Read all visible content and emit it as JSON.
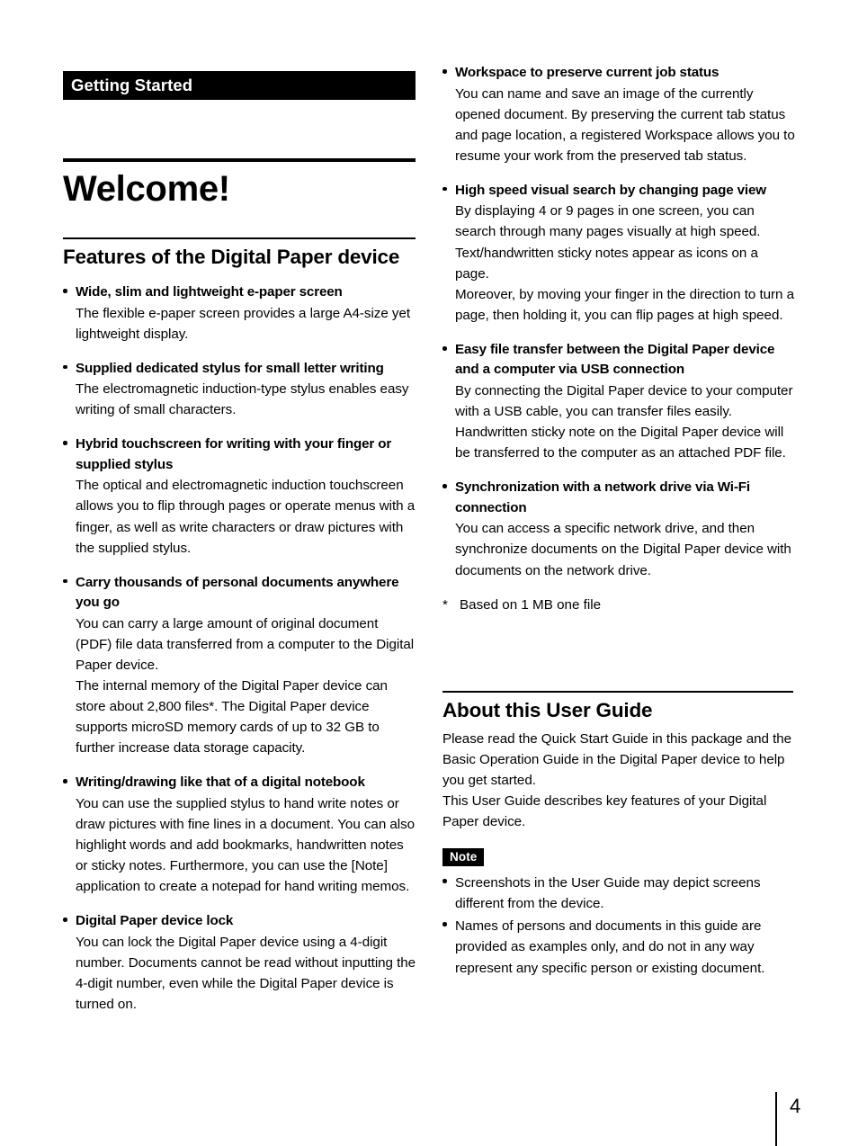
{
  "page": {
    "chapter_label": "Getting Started",
    "doc_title": "Welcome!",
    "page_number": "4"
  },
  "features_section": {
    "heading": "Features of the Digital Paper device",
    "items": [
      {
        "title": "Wide, slim and lightweight e-paper screen",
        "body": "The flexible e-paper screen provides a large A4-size yet lightweight display."
      },
      {
        "title": "Supplied dedicated stylus for small letter writing",
        "body": "The electromagnetic induction-type stylus enables easy writing of small characters."
      },
      {
        "title": "Hybrid touchscreen for writing with your finger or supplied stylus",
        "body": "The optical and electromagnetic induction touchscreen allows you to flip through pages or operate menus with a finger, as well as write characters or draw pictures with the supplied stylus."
      },
      {
        "title": "Carry thousands of personal documents anywhere you go",
        "body": "You can carry a large amount of original document (PDF) file data transferred from a computer to the Digital Paper device.\nThe internal memory of the Digital Paper device can store about 2,800 files*. The Digital Paper device supports microSD memory cards of up to 32 GB to further increase data storage capacity."
      },
      {
        "title": "Writing/drawing like that of a digital notebook",
        "body": "You can use the supplied stylus to hand write notes or draw pictures with fine lines in a document. You can also highlight words and add bookmarks, handwritten notes or sticky notes. Furthermore, you can use the [Note] application to create a notepad for hand writing memos."
      },
      {
        "title": "Digital Paper device lock",
        "body": "You can lock the Digital Paper device using a 4-digit number. Documents cannot be read without inputting the 4-digit number, even while the Digital Paper device is turned on."
      }
    ],
    "items_right": [
      {
        "title": "Workspace to preserve current job status",
        "body": "You can name and save an image of the currently opened document. By preserving the current tab status and page location, a registered Workspace allows you to resume your work from the preserved tab status."
      },
      {
        "title": "High speed visual search by changing page view",
        "body": "By displaying 4 or 9 pages in one screen, you can search through many pages visually at high speed. Text/handwritten sticky notes appear as icons on a page.\nMoreover, by moving your finger in the direction to turn a page, then holding it, you can flip pages at high speed."
      },
      {
        "title": "Easy file transfer between the Digital Paper device and a computer via USB connection",
        "body": "By connecting the Digital Paper device to your computer with a USB cable, you can transfer files easily. Handwritten sticky note on the Digital Paper device will be transferred to the computer as an attached PDF file."
      },
      {
        "title": "Synchronization with a network drive via Wi-Fi connection",
        "body": "You can access a specific network drive, and then synchronize documents on the Digital Paper device with documents on the network drive."
      }
    ],
    "footnote_marker": "*",
    "footnote_text": "Based on 1 MB one file"
  },
  "about_section": {
    "heading": "About this User Guide",
    "body": "Please read the Quick Start Guide in this package and the Basic Operation Guide in the Digital Paper device to help you get started.\nThis User Guide describes key features of your Digital Paper device.",
    "note_badge": "Note",
    "notes": [
      "Screenshots in the User Guide may depict screens different from the device.",
      "Names of persons and documents in this guide are provided as examples only, and do not in any way represent any specific person or existing document."
    ]
  }
}
